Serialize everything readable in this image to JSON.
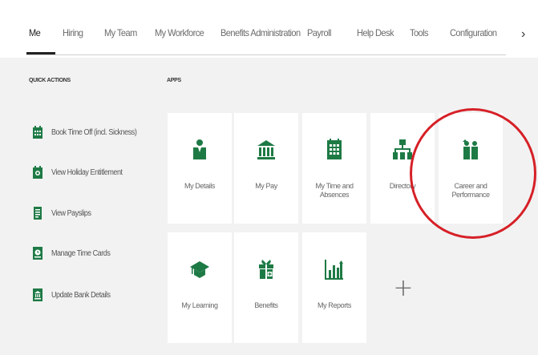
{
  "nav": {
    "items": [
      {
        "label": "Me",
        "active": true
      },
      {
        "label": "Hiring"
      },
      {
        "label": "My Team"
      },
      {
        "label": "My Workforce"
      },
      {
        "label": "Benefits Administration"
      },
      {
        "label": "Payroll"
      },
      {
        "label": "Help Desk"
      },
      {
        "label": "Tools"
      },
      {
        "label": "Configuration"
      }
    ],
    "more_icon": "chevron-right-icon",
    "more_glyph": "›"
  },
  "quick_actions": {
    "heading": "QUICK ACTIONS",
    "items": [
      {
        "label": "Book Time Off (incl. Sickness)",
        "icon": "calendar-icon"
      },
      {
        "label": "View Holiday Entitlement",
        "icon": "holiday-icon"
      },
      {
        "label": "View Payslips",
        "icon": "payslip-icon"
      },
      {
        "label": "Manage Time Cards",
        "icon": "time-card-icon"
      },
      {
        "label": "Update Bank Details",
        "icon": "bank-icon"
      }
    ]
  },
  "apps": {
    "heading": "APPS",
    "tiles": [
      {
        "label": "My Details",
        "icon": "person-icon"
      },
      {
        "label": "My Pay",
        "icon": "bank-building-icon"
      },
      {
        "label": "My Time and Absences",
        "icon": "calendar-grid-icon"
      },
      {
        "label": "Directory",
        "icon": "org-chart-icon"
      },
      {
        "label": "Career and Performance",
        "icon": "career-people-icon"
      },
      {
        "label": "My Learning",
        "icon": "graduation-cap-icon"
      },
      {
        "label": "Benefits",
        "icon": "gift-icon"
      },
      {
        "label": "My Reports",
        "icon": "bar-chart-icon"
      }
    ],
    "add_glyph": "+"
  },
  "colors": {
    "accent_green": "#1e7a45",
    "annotation_red": "#d62027",
    "background": "#f2f2f2"
  }
}
